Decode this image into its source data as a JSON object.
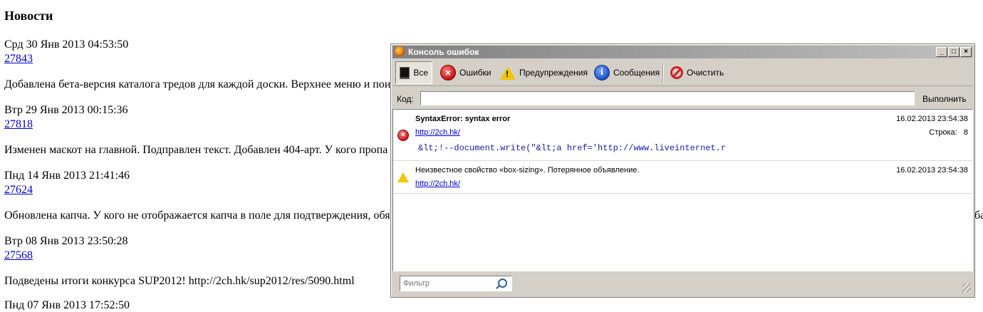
{
  "page": {
    "heading": "Новости",
    "news": [
      {
        "date": "Срд 30 Янв 2013 04:53:50",
        "id": "27843",
        "text": "Добавлена бета-версия каталога тредов для каждой доски. Верхнее меню и пои"
      },
      {
        "date": "Втр 29 Янв 2013 00:15:36",
        "id": "27818",
        "text": "Изменен маскот на главной. Подправлен текст. Добавлен 404-арт. У кого пропа"
      },
      {
        "date": "Пнд 14 Янв 2013 21:41:46",
        "id": "27624",
        "text": "Обновлена капча. У кого не отображается капча в поле для подтверждения, обя",
        "tail": "ба"
      },
      {
        "date": "Втр 08 Янв 2013 23:50:28",
        "id": "27568",
        "text": "Подведены итоги конкурса SUP2012! http://2ch.hk/sup2012/res/5090.html"
      },
      {
        "date": "Пнд 07 Янв 2013 17:52:50"
      }
    ]
  },
  "console": {
    "title": "Консоль ошибок",
    "window_buttons": {
      "min": "_",
      "max": "□",
      "close": "×"
    },
    "toolbar": {
      "all": "Все",
      "errors": "Ошибки",
      "warnings": "Предупреждения",
      "messages": "Сообщения",
      "clear": "Очистить"
    },
    "code_label": "Код:",
    "code_value": "",
    "run_label": "Выполнить",
    "messages": [
      {
        "type": "error",
        "title": "SyntaxError: syntax error",
        "source": "http://2ch.hk/",
        "time": "16.02.2013 23:54:38",
        "line_label": "Строка:",
        "line": "8",
        "snippet": "&lt;!--document.write(\"&lt;a href='http://www.liveinternet.r"
      },
      {
        "type": "warning",
        "title": "Неизвестное свойство «box-sizing».  Потерянное объявление.",
        "source": "http://2ch.hk/",
        "time": "16.02.2013 23:54:38"
      }
    ],
    "filter_placeholder": "Фильтр"
  }
}
